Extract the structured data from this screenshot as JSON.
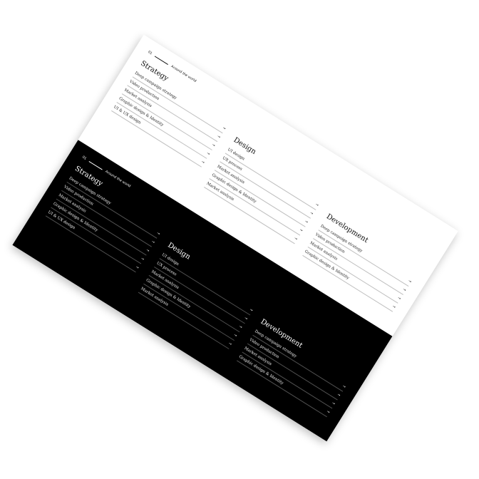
{
  "light": {
    "label_num": "01",
    "label_text": "Around the world",
    "columns": [
      {
        "title": "Strategy",
        "items": [
          "Deep campaign strategy",
          "Video production",
          "Market analysis",
          "Graphic design & Identity",
          "UI & UX design"
        ]
      },
      {
        "title": "Design",
        "items": [
          "UI design",
          "UX process",
          "Market analysis",
          "Graphic design & Identity",
          "Market analysis"
        ]
      },
      {
        "title": "Development",
        "items": [
          "Deep campaign strategy",
          "Video production",
          "Market analysis",
          "Graphic design & Identity"
        ]
      }
    ]
  },
  "dark": {
    "label_num": "01",
    "label_text": "Around the world",
    "columns": [
      {
        "title": "Strategy",
        "items": [
          "Deep campaign strategy",
          "Video production",
          "Market analysis",
          "Graphic design & Identity",
          "UI & UX design"
        ]
      },
      {
        "title": "Design",
        "items": [
          "UI design",
          "UX process",
          "Market analysis",
          "Graphic design & Identity",
          "Market analysis"
        ]
      },
      {
        "title": "Development",
        "items": [
          "Deep campaign strategy",
          "Video production",
          "Market analysis",
          "Graphic design & Identity"
        ]
      }
    ]
  },
  "icons": {
    "item_arrow": "→"
  }
}
